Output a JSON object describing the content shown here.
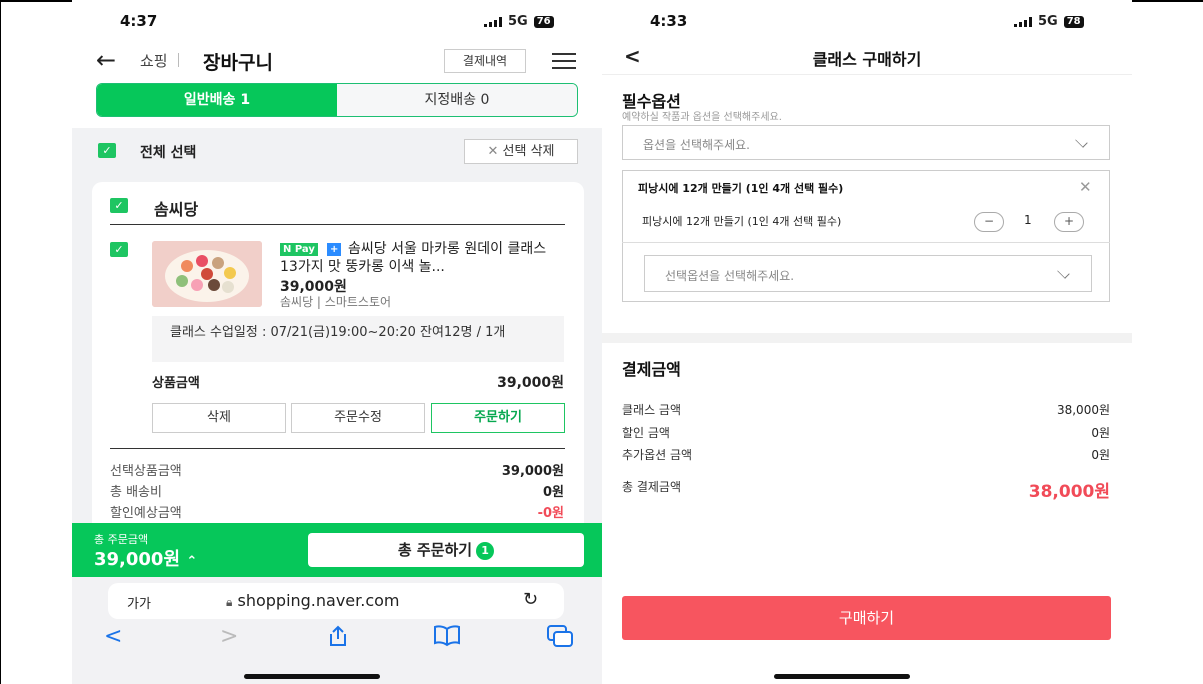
{
  "left": {
    "status": {
      "time": "4:37",
      "network": "5G",
      "battery": "76"
    },
    "header": {
      "breadcrumb": "쇼핑",
      "title": "장바구니",
      "history_button": "결제내역"
    },
    "tabs": [
      {
        "label": "일반배송 1"
      },
      {
        "label": "지정배송 0"
      }
    ],
    "select_all": "전체 선택",
    "delete_selected": "선택 삭제",
    "shop": {
      "name": "솜씨당",
      "product": {
        "npay": "N Pay",
        "name": "솜씨당 서울 마카롱 원데이 클래스 13가지 맛 뚱카롱 이색 놀...",
        "price": "39,000원",
        "seller": "솜씨당 | 스마트스토어",
        "schedule": "클래스 수업일정 : 07/21(금)19:00~20:20 잔여12명 / 1개"
      },
      "amount_label": "상품금액",
      "amount_value": "39,000원",
      "buttons": {
        "delete": "삭제",
        "edit": "주문수정",
        "order": "주문하기"
      }
    },
    "summary": [
      {
        "label": "선택상품금액",
        "value": "39,000원"
      },
      {
        "label": "총 배송비",
        "value": "0원"
      },
      {
        "label": "할인예상금액",
        "value": "-0원"
      }
    ],
    "bottom": {
      "total_label": "총 주문금액",
      "total_value": "39,000원",
      "order_button": "총 주문하기",
      "order_count": "1"
    },
    "browser": {
      "aa": "가가",
      "url": "shopping.naver.com"
    }
  },
  "right": {
    "status": {
      "time": "4:33",
      "network": "5G",
      "battery": "78"
    },
    "title": "클래스 구매하기",
    "required_options": {
      "heading": "필수옵션",
      "sub": "예약하실 작품과 옵션을 선택해주세요.",
      "placeholder": "옵션을 선택해주세요.",
      "selected": {
        "title": "피낭시에 12개 만들기 (1인 4개 선택 필수)",
        "item": "피낭시에 12개 만들기 (1인 4개 선택 필수)",
        "quantity": "1",
        "sub_placeholder": "선택옵션을 선택해주세요."
      }
    },
    "payment": {
      "heading": "결제금액",
      "rows": [
        {
          "label": "클래스 금액",
          "value": "38,000원"
        },
        {
          "label": "할인 금액",
          "value": "0원"
        },
        {
          "label": "추가옵션 금액",
          "value": "0원"
        }
      ],
      "total_label": "총 결제금액",
      "total_value": "38,000원"
    },
    "buy_button": "구매하기"
  }
}
